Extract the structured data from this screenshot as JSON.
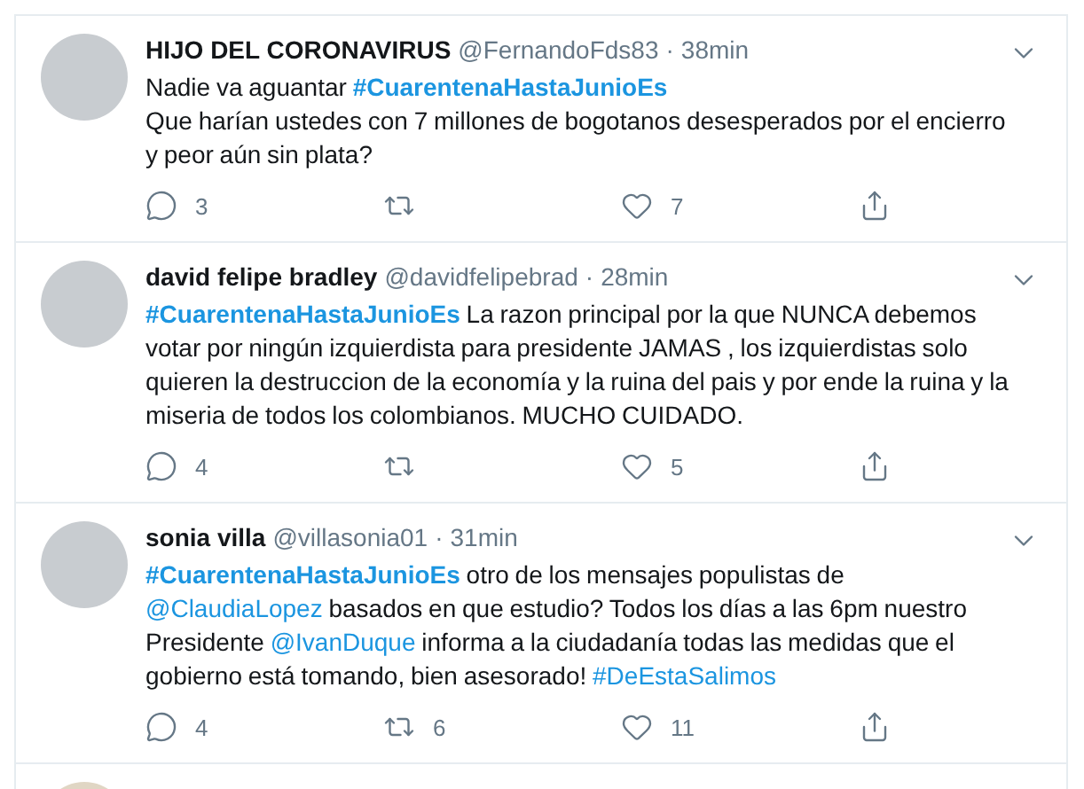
{
  "tweets": [
    {
      "name": "HIJO DEL CORONAVIRUS",
      "handle": "@FernandoFds83",
      "separator": "·",
      "time": "38min",
      "body": [
        {
          "kind": "text",
          "text": "Nadie va aguantar "
        },
        {
          "kind": "hashtag",
          "text": "#CuarentenaHastaJunioEs",
          "bold": true
        },
        {
          "kind": "break"
        },
        {
          "kind": "text",
          "text": "Que harían ustedes con 7 millones de bogotanos desesperados por el encierro y peor aún sin plata?"
        }
      ],
      "actions": [
        {
          "kind": "reply",
          "count": "3"
        },
        {
          "kind": "retweet"
        },
        {
          "kind": "like",
          "count": "7"
        },
        {
          "kind": "share"
        }
      ]
    },
    {
      "name": "david felipe bradley",
      "handle": "@davidfelipebrad",
      "separator": "·",
      "time": "28min",
      "body": [
        {
          "kind": "hashtag",
          "text": "#CuarentenaHastaJunioEs",
          "bold": true
        },
        {
          "kind": "text",
          "text": " La razon principal por la que NUNCA debemos votar por ningún izquierdista para presidente JAMAS ,  los izquierdistas solo quieren la destruccion de la economía y la ruina del pais y por ende la ruina y la miseria de todos los colombianos. MUCHO CUIDADO."
        }
      ],
      "actions": [
        {
          "kind": "reply",
          "count": "4"
        },
        {
          "kind": "retweet"
        },
        {
          "kind": "like",
          "count": "5"
        },
        {
          "kind": "share"
        }
      ]
    },
    {
      "name": "sonia villa",
      "handle": "@villasonia01",
      "separator": "·",
      "time": "31min",
      "body": [
        {
          "kind": "hashtag",
          "text": "#CuarentenaHastaJunioEs",
          "bold": true
        },
        {
          "kind": "text",
          "text": " otro de los mensajes populistas de "
        },
        {
          "kind": "mention",
          "text": "@ClaudiaLopez"
        },
        {
          "kind": "text",
          "text": " basados en que estudio? Todos los días a las 6pm nuestro Presidente "
        },
        {
          "kind": "mention",
          "text": "@IvanDuque"
        },
        {
          "kind": "text",
          "text": " informa a la ciudadanía todas las medidas que el gobierno está tomando, bien asesorado! "
        },
        {
          "kind": "hashtag",
          "text": "#DeEstaSalimos",
          "bold": false
        }
      ],
      "actions": [
        {
          "kind": "reply",
          "count": "4"
        },
        {
          "kind": "retweet",
          "count": "6"
        },
        {
          "kind": "like",
          "count": "11"
        },
        {
          "kind": "share"
        }
      ]
    }
  ],
  "next_tweet": {
    "partial": true
  }
}
